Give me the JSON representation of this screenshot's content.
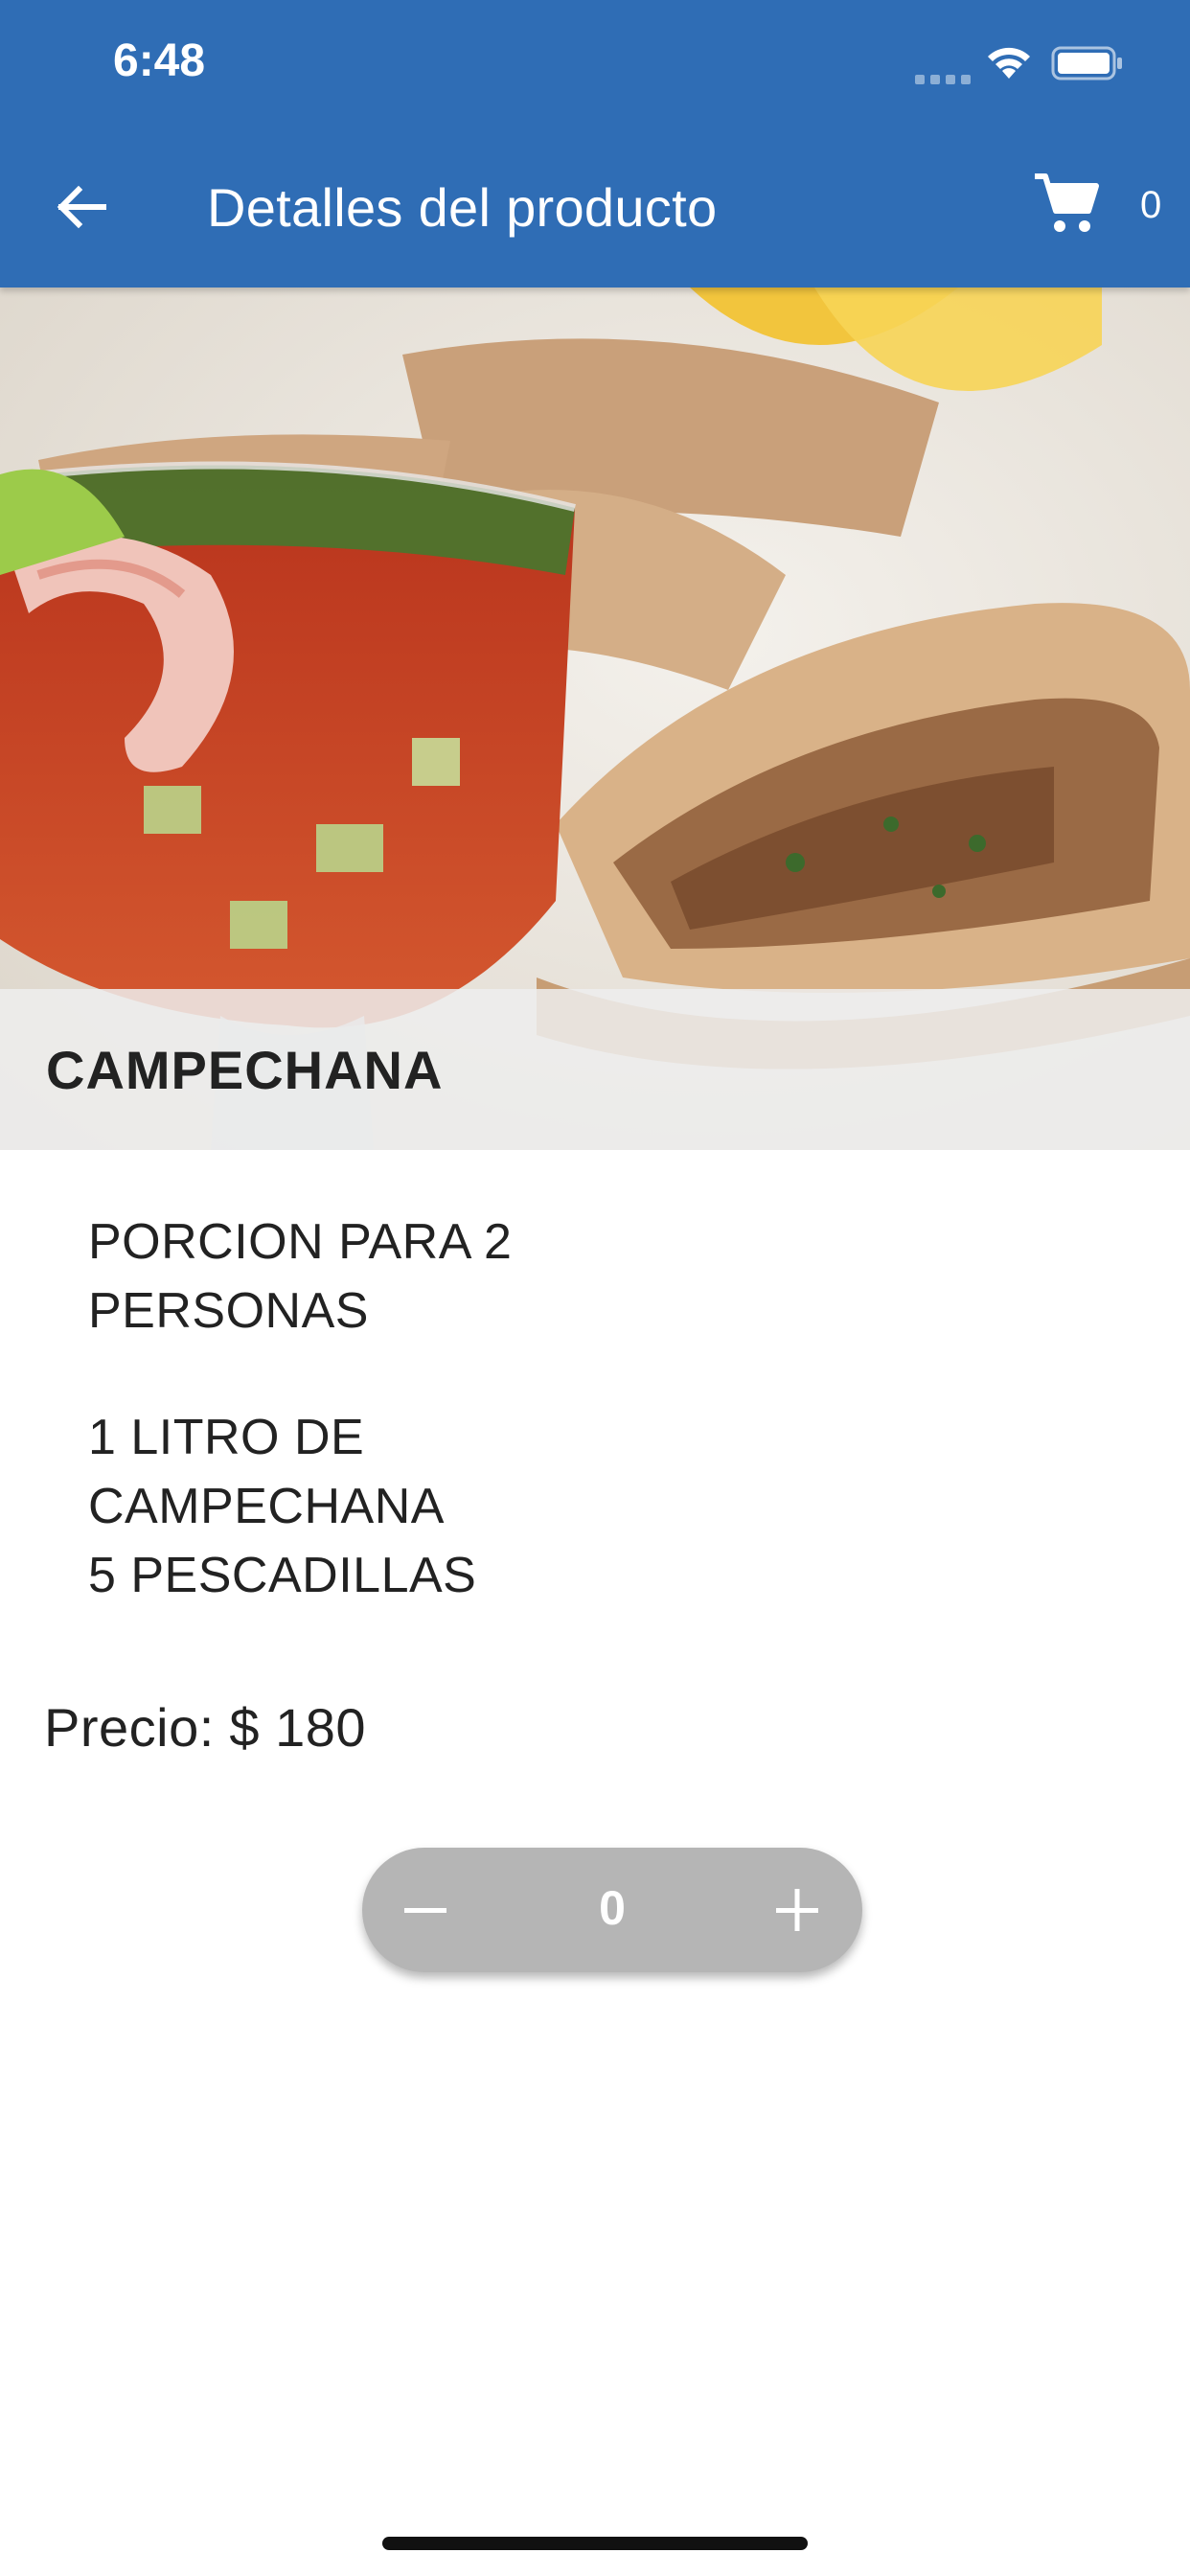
{
  "status_bar": {
    "time": "6:48"
  },
  "app_bar": {
    "title": "Detalles del producto",
    "cart_count": "0"
  },
  "product": {
    "name": "CAMPECHANA",
    "description_1": "PORCION PARA 2\nPERSONAS",
    "description_2": "1 LITRO DE\nCAMPECHANA\n5 PESCADILLAS",
    "price_label": "Precio:",
    "price_value": "$ 180"
  },
  "stepper": {
    "value": "0"
  },
  "colors": {
    "primary": "#2f6db5",
    "stepper": "#b5b5b5"
  }
}
